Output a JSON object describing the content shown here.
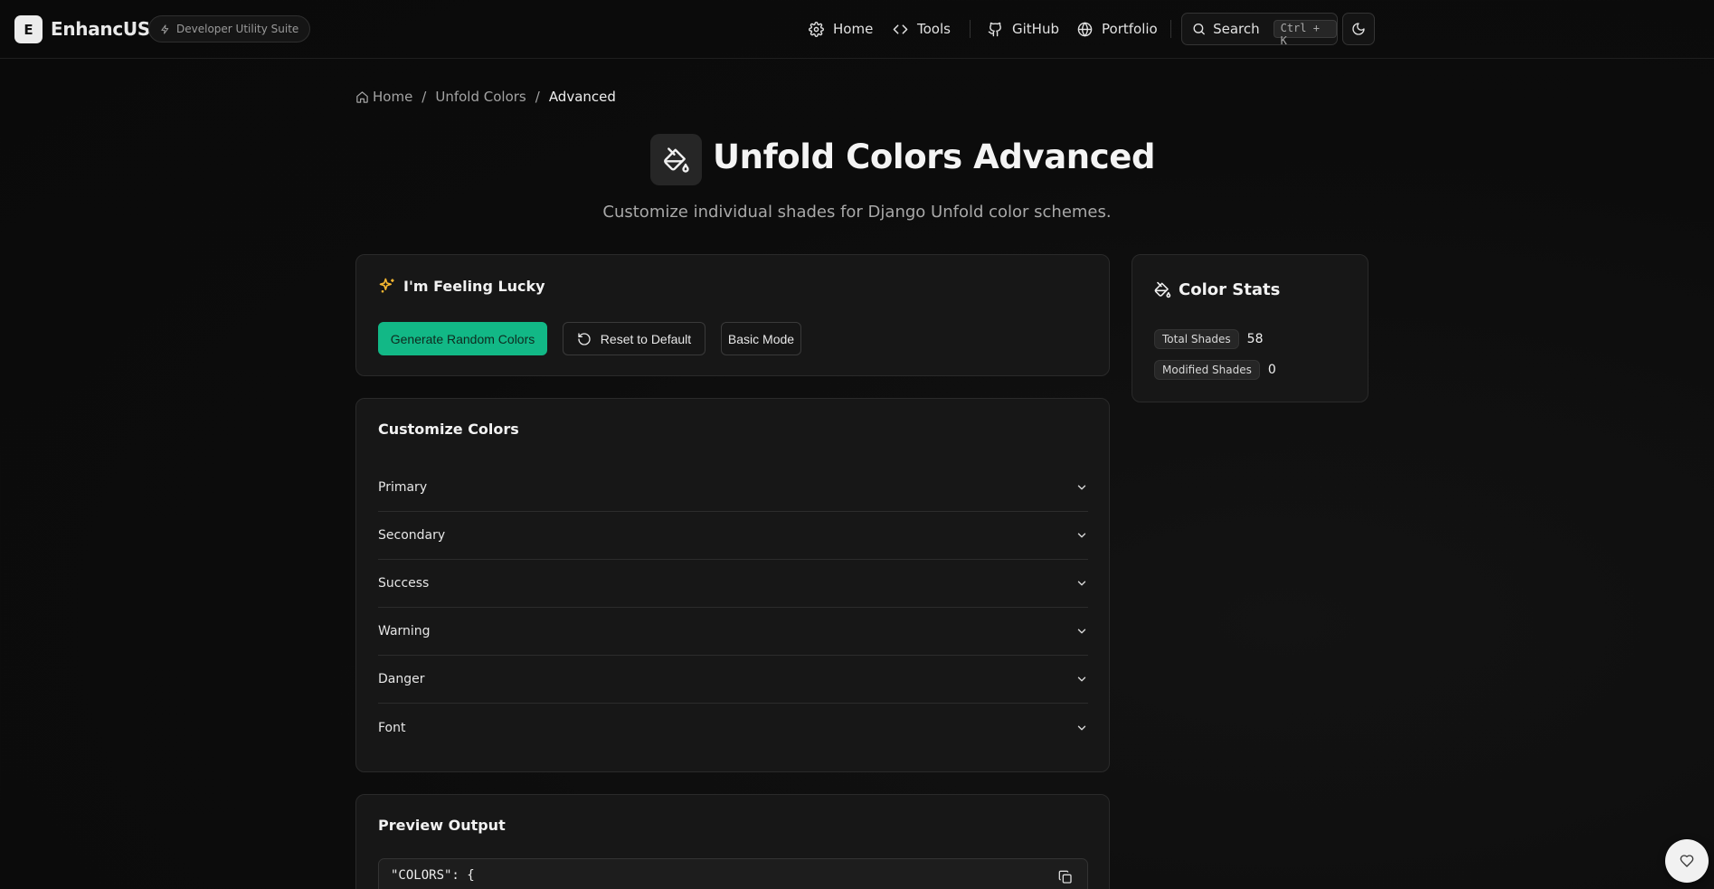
{
  "header": {
    "logo_letter": "E",
    "brand": "EnhancUS",
    "badge": "Developer Utility Suite",
    "nav": [
      {
        "label": "Home",
        "icon": "gear-icon"
      },
      {
        "label": "Tools",
        "icon": "code-icon"
      },
      {
        "label": "GitHub",
        "icon": "github-icon"
      },
      {
        "label": "Portfolio",
        "icon": "globe-icon"
      }
    ],
    "search_label": "Search",
    "search_shortcut": "Ctrl + K",
    "theme_icon": "moon-icon"
  },
  "breadcrumb": {
    "items": [
      "Home",
      "Unfold Colors",
      "Advanced"
    ],
    "separator": "/"
  },
  "page": {
    "title": "Unfold Colors Advanced",
    "subtitle": "Customize individual shades for Django Unfold color schemes.",
    "title_icon": "paint-bucket-icon"
  },
  "lucky": {
    "heading": "I'm Feeling Lucky",
    "generate_label": "Generate Random Colors",
    "reset_label": "Reset to Default",
    "basic_label": "Basic Mode"
  },
  "stats": {
    "heading": "Color Stats",
    "total_label": "Total Shades",
    "total_value": "58",
    "modified_label": "Modified Shades",
    "modified_value": "0"
  },
  "customize": {
    "heading": "Customize Colors",
    "groups": [
      "Primary",
      "Secondary",
      "Success",
      "Warning",
      "Danger",
      "Font"
    ]
  },
  "preview": {
    "heading": "Preview Output",
    "code_first_line": "\"COLORS\": {"
  },
  "colors": {
    "accent_green": "#12b886",
    "sparkle_yellow": "#f4b731",
    "background": "#0b0b0b",
    "card": "#171717"
  }
}
